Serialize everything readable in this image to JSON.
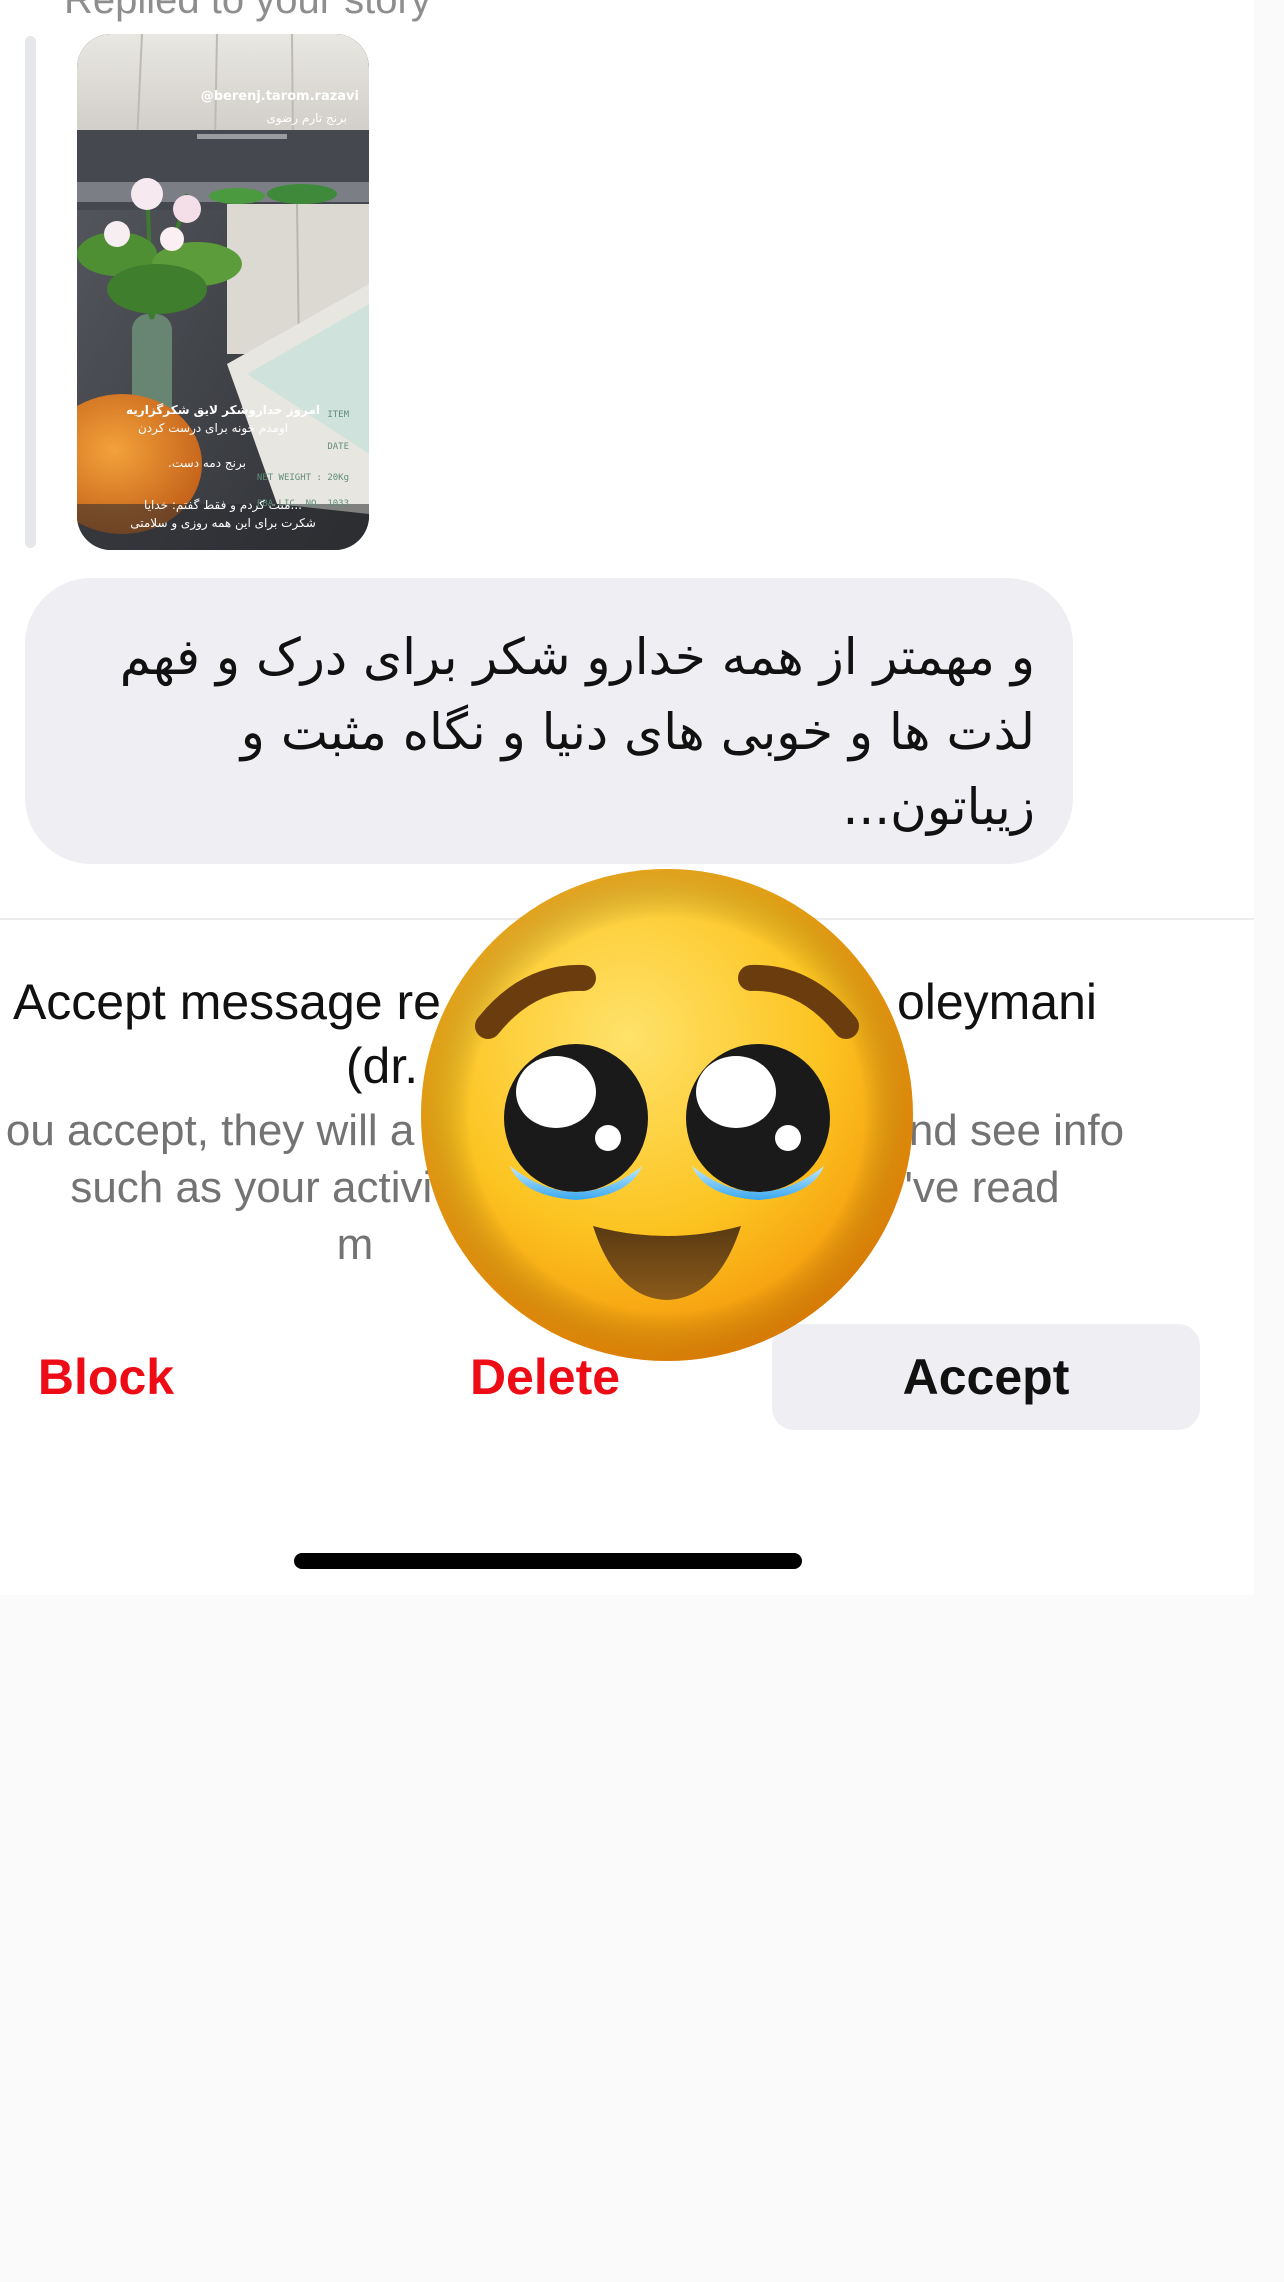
{
  "thread": {
    "replied_caption": "Replied to your story",
    "story_preview": {
      "watermark": "@berenj.tarom.razavi",
      "subtitle": "برنج تارم رضوی",
      "caption_lines": [
        "امروز خداروشکر لایق شکرگزاریه",
        "اومدم خونه برای درست کردن",
        "برنج دمه دست.",
        "...منت کردم و فقط گفتم: خدایا",
        "شکرت برای این همه روزی و سلامتی"
      ],
      "bag_label_lines": [
        "ITEM",
        "DATE",
        "NET WEIGHT : 20Kg",
        "PBA LIC. NO. 1033"
      ]
    },
    "message_text": "و مهمتر از همه خدارو شکر برای درک و فهم لذت ها و خوبی های دنیا و نگاه مثبت و زیباتون..."
  },
  "request": {
    "title_line1_left": "Accept message re",
    "title_line1_right": "oleymani",
    "title_line2": "(dr.",
    "info_line1_left": "ou accept, they will a",
    "info_line1_right": "and see info",
    "info_line2_left": "such as your activit",
    "info_line2_right": "'ve read",
    "info_line3": "m"
  },
  "actions": {
    "block_label": "Block",
    "delete_label": "Delete",
    "accept_label": "Accept"
  },
  "colors": {
    "destructive": "#ed0b15",
    "bubble_background": "#efeff3",
    "muted_text": "#737373"
  },
  "overlay": {
    "emoji": "face-holding-back-tears"
  }
}
